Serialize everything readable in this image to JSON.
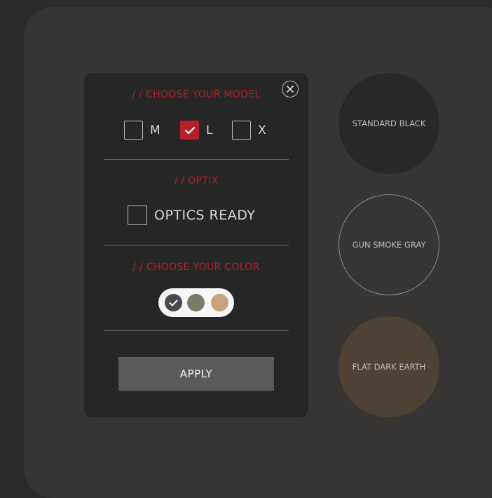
{
  "dialog": {
    "model_title": "/ / CHOOSE YOUR MODEL",
    "models": [
      {
        "label": "M",
        "checked": false
      },
      {
        "label": "L",
        "checked": true
      },
      {
        "label": "X",
        "checked": false
      }
    ],
    "optix_title": "/ / OPTIX",
    "optics_ready": {
      "label": "OPTICS READY",
      "checked": false
    },
    "color_title": "/ / CHOOSE YOUR COLOR",
    "swatches": [
      {
        "color": "#4a4a4a",
        "selected": true
      },
      {
        "color": "#7b7a66",
        "selected": false
      },
      {
        "color": "#c7a27d",
        "selected": false
      }
    ],
    "apply_label": "APPLY",
    "close_icon": "close-icon"
  },
  "colors": {
    "accent": "#b5202b",
    "standard_black": "#282828",
    "gun_smoke_gray": "#363533",
    "flat_dark_earth": "#4e4234"
  },
  "color_options": [
    {
      "label": "STANDARD BLACK"
    },
    {
      "label": "GUN SMOKE GRAY"
    },
    {
      "label": "FLAT DARK EARTH"
    }
  ]
}
